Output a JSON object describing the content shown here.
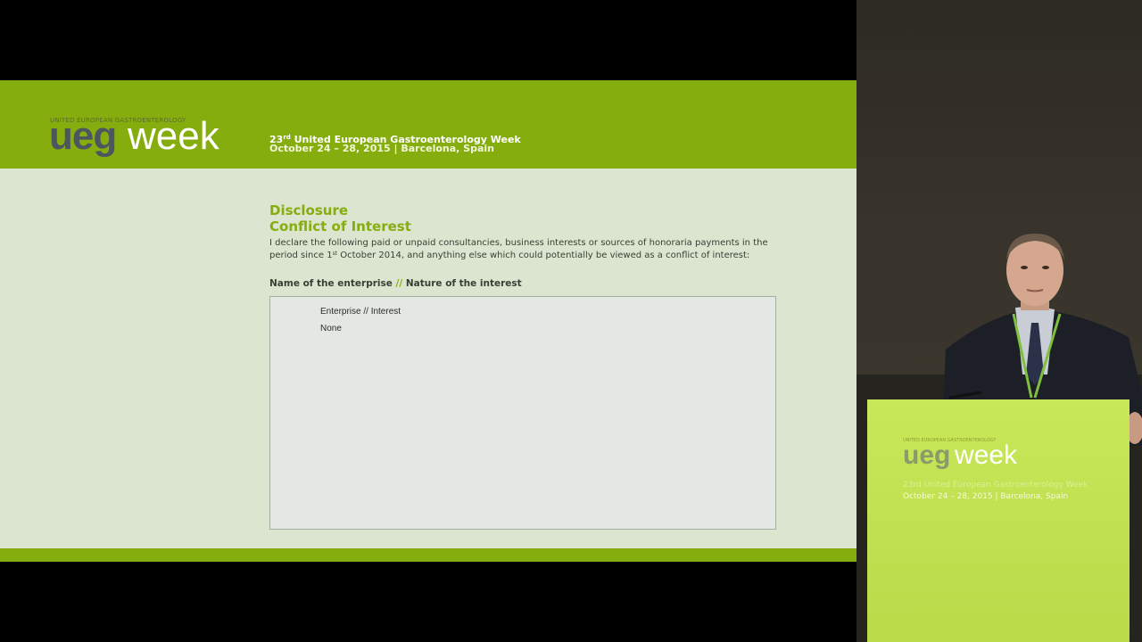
{
  "header": {
    "logo": {
      "small_text": "United European Gastroenterology",
      "ueg": "ueg",
      "week": "week"
    },
    "edition_num": "23",
    "edition_sup": "rd",
    "event_name": " United European Gastroenterology Week",
    "date_location": "October 24 – 28, 2015 | Barcelona, Spain"
  },
  "content": {
    "title_line1": "Disclosure",
    "title_line2": "Conflict of Interest",
    "intro_part1": "I declare the following paid or unpaid consultancies, business interests or sources of honoraria payments in the period since 1",
    "intro_sup": "st",
    "intro_part2": " October 2014, and anything else which could potentially be viewed as a conflict of interest:",
    "subhead_left": "Name of the enterprise ",
    "subhead_sep": "//",
    "subhead_right": " Nature of the interest",
    "box_rows": [
      "Enterprise // Interest",
      "None"
    ]
  },
  "podium": {
    "small_text": "United European Gastroenterology",
    "ueg": "ueg",
    "week": "week",
    "line1": "23rd United European Gastroenterology Week",
    "line2": "October 24 – 28, 2015 | Barcelona, Spain"
  },
  "colors": {
    "brand_green": "#86ad0e",
    "slide_bg": "#dce5cf",
    "podium_green": "#c8e85a"
  }
}
